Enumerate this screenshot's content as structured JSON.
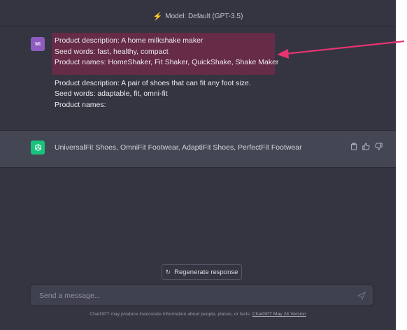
{
  "model_bar": {
    "label": "Model: Default (GPT-3.5)"
  },
  "user_message": {
    "avatar_initials": "MI",
    "example_lines": [
      "Product description: A home milkshake maker",
      "Seed words: fast, healthy, compact",
      "Product names: HomeShaker, Fit Shaker, QuickShake, Shake Maker"
    ],
    "query_lines": [
      "Product description: A pair of shoes that can fit any foot size.",
      "Seed words:  adaptable, fit, omni-fit",
      "Product names:"
    ]
  },
  "assistant_message": {
    "text": "UniversalFit Shoes, OmniFit Footwear, AdaptiFit Shoes, PerfectFit Footwear",
    "actions": [
      "copy-icon",
      "thumbs-up-icon",
      "thumbs-down-icon"
    ]
  },
  "regenerate": {
    "label": "Regenerate response",
    "icon": "refresh-icon"
  },
  "input": {
    "placeholder": "Send a message...",
    "value": ""
  },
  "footer": {
    "text": "ChatGPT may produce inaccurate information about people, places, or facts. ",
    "link": "ChatGPT May 24 Version"
  },
  "colors": {
    "background": "#343541",
    "assistant_background": "#444654",
    "highlight": "#6b2a48",
    "annotation_arrow": "#e8336f",
    "gpt_avatar": "#19c37d",
    "user_avatar": "#8e5cbf"
  }
}
